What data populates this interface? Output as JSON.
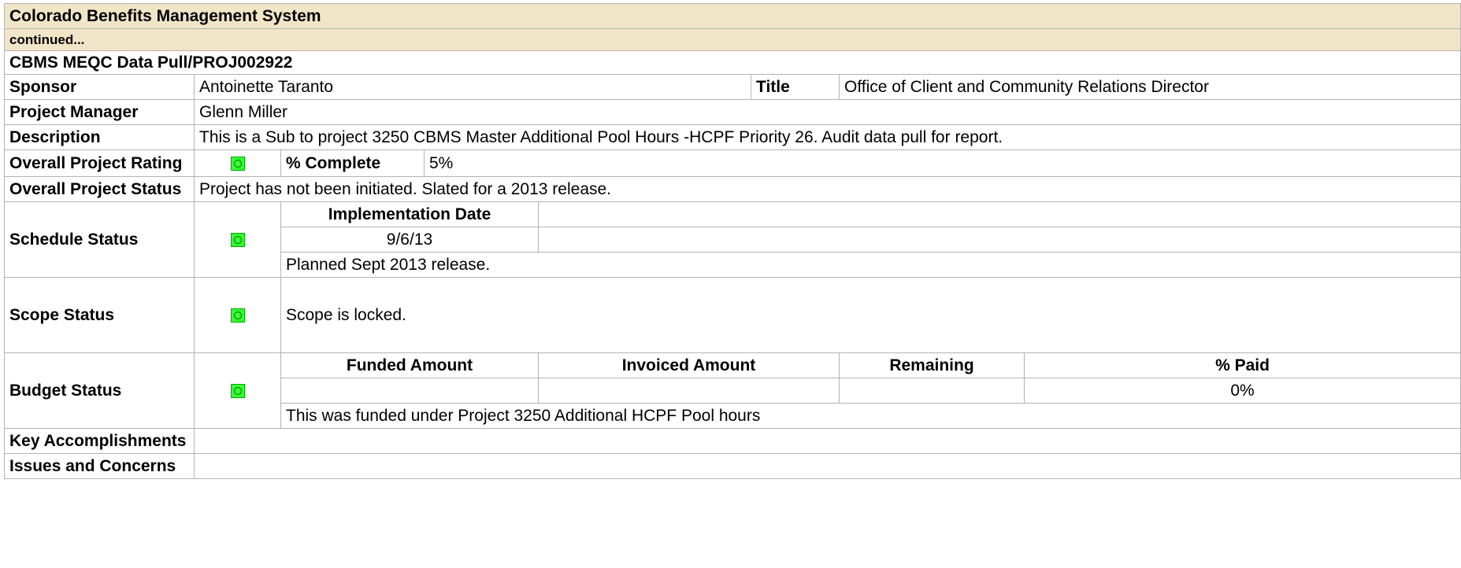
{
  "header": {
    "system_title": "Colorado Benefits Management System",
    "continued": "continued...",
    "project_title": "CBMS MEQC Data Pull/PROJ002922"
  },
  "sponsor": {
    "label": "Sponsor",
    "value": "Antoinette Taranto"
  },
  "title": {
    "label": "Title",
    "value": "Office of Client and Community Relations Director"
  },
  "project_manager": {
    "label": "Project Manager",
    "value": "Glenn Miller"
  },
  "description": {
    "label": "Description",
    "value": "This is  a Sub to project  3250 CBMS Master Additional Pool Hours -HCPF Priority 26. Audit data pull for report."
  },
  "overall_rating": {
    "label": "Overall Project Rating",
    "status_color": "#33ff33",
    "percent_label": "% Complete",
    "percent_value": "5%"
  },
  "overall_status": {
    "label": "Overall Project Status",
    "value": "Project has not been initiated.  Slated for a 2013 release."
  },
  "schedule": {
    "label": "Schedule Status",
    "status_color": "#33ff33",
    "impl_date_header": "Implementation Date",
    "impl_date_value": "9/6/13",
    "note": "Planned Sept 2013 release."
  },
  "scope": {
    "label": "Scope Status",
    "status_color": "#33ff33",
    "note": "Scope is locked."
  },
  "budget": {
    "label": "Budget Status",
    "status_color": "#33ff33",
    "columns": [
      "Funded Amount",
      "Invoiced Amount",
      "Remaining",
      "% Paid"
    ],
    "values": [
      "",
      "",
      "",
      "0%"
    ],
    "note": "This was funded under Project 3250 Additional HCPF Pool hours"
  },
  "key_accomplishments": {
    "label": "Key Accomplishments",
    "value": ""
  },
  "issues": {
    "label": "Issues and Concerns",
    "value": ""
  }
}
